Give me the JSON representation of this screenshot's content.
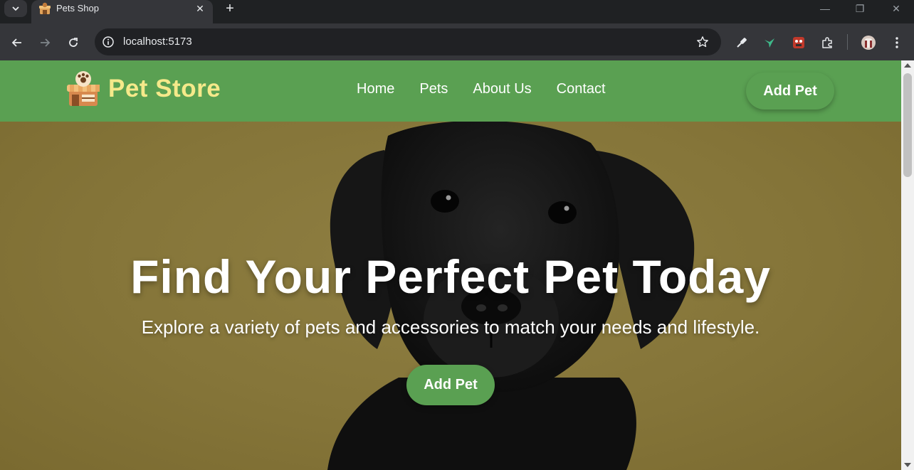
{
  "browser": {
    "tab_title": "Pets Shop",
    "tab_close": "✕",
    "new_tab": "+",
    "url": "localhost:5173",
    "window_controls": {
      "minimize": "—",
      "restore": "❐",
      "close": "✕"
    },
    "icons": [
      "tab-list-icon",
      "back-icon",
      "forward-icon",
      "reload-icon",
      "site-info-icon",
      "bookmark-star-icon",
      "eyedropper-extension-icon",
      "bird-extension-icon",
      "red-extension-icon",
      "puzzle-extensions-icon",
      "profile-avatar-icon",
      "kebab-menu-icon"
    ]
  },
  "navbar": {
    "brand": "Pet Store",
    "links": [
      "Home",
      "Pets",
      "About Us",
      "Contact"
    ],
    "cta": "Add Pet",
    "background": "#5aa052",
    "brand_color": "#f5e98a"
  },
  "hero": {
    "title": "Find Your Perfect Pet Today",
    "subtitle": "Explore a variety of pets and accessories to match your needs and lifestyle.",
    "button": "Add Pet",
    "background": "#857539",
    "image": "black-labrador-puppy"
  }
}
